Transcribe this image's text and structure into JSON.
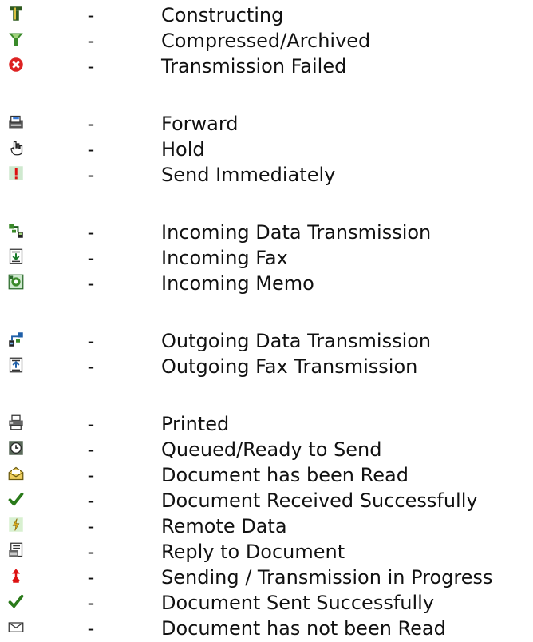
{
  "separator": "-",
  "groups": [
    {
      "items": [
        {
          "icon": "constructing-icon",
          "label": "Constructing"
        },
        {
          "icon": "compressed-archived-icon",
          "label": "Compressed/Archived"
        },
        {
          "icon": "transmission-failed-icon",
          "label": "Transmission Failed"
        }
      ]
    },
    {
      "items": [
        {
          "icon": "forward-icon",
          "label": "Forward"
        },
        {
          "icon": "hold-icon",
          "label": "Hold"
        },
        {
          "icon": "send-immediately-icon",
          "label": "Send Immediately"
        }
      ]
    },
    {
      "items": [
        {
          "icon": "incoming-data-transmission-icon",
          "label": "Incoming Data Transmission"
        },
        {
          "icon": "incoming-fax-icon",
          "label": "Incoming Fax"
        },
        {
          "icon": "incoming-memo-icon",
          "label": "Incoming Memo"
        }
      ]
    },
    {
      "items": [
        {
          "icon": "outgoing-data-transmission-icon",
          "label": "Outgoing Data Transmission"
        },
        {
          "icon": "outgoing-fax-transmission-icon",
          "label": "Outgoing Fax Transmission"
        }
      ]
    },
    {
      "items": [
        {
          "icon": "printed-icon",
          "label": "Printed"
        },
        {
          "icon": "queued-ready-to-send-icon",
          "label": "Queued/Ready to Send"
        },
        {
          "icon": "document-read-icon",
          "label": "Document has been Read"
        },
        {
          "icon": "document-received-successfully-icon",
          "label": "Document Received Successfully"
        },
        {
          "icon": "remote-data-icon",
          "label": "Remote Data"
        },
        {
          "icon": "reply-to-document-icon",
          "label": "Reply to Document"
        },
        {
          "icon": "sending-in-progress-icon",
          "label": "Sending / Transmission in Progress"
        },
        {
          "icon": "document-sent-successfully-icon",
          "label": "Document Sent Successfully"
        },
        {
          "icon": "document-not-read-icon",
          "label": "Document has not been Read"
        }
      ]
    }
  ]
}
